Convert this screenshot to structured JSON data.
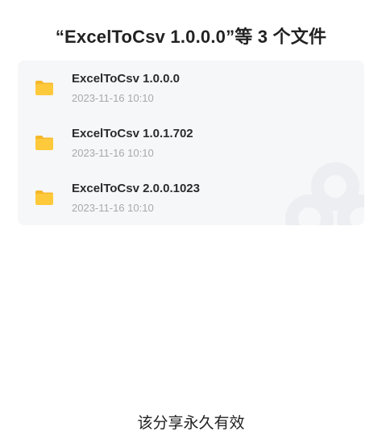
{
  "title": "“ExcelToCsv 1.0.0.0”等 3 个文件",
  "files": [
    {
      "name": "ExcelToCsv 1.0.0.0",
      "time": "2023-11-16 10:10",
      "icon": "folder-icon"
    },
    {
      "name": "ExcelToCsv 1.0.1.702",
      "time": "2023-11-16 10:10",
      "icon": "folder-icon"
    },
    {
      "name": "ExcelToCsv 2.0.0.1023",
      "time": "2023-11-16 10:10",
      "icon": "folder-icon"
    }
  ],
  "footer": "该分享永久有效",
  "colors": {
    "folder": "#ffc93c",
    "folder_tab": "#f5b82a",
    "card_bg": "#f6f7f9",
    "time_text": "#a7a9ad"
  }
}
